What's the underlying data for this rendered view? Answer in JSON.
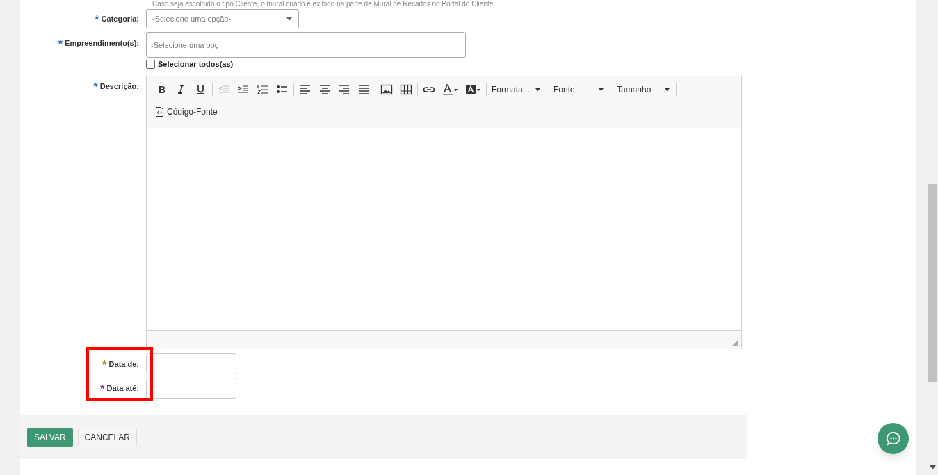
{
  "hint": "Caso seja escolhido o tipo Cliente, o mural criado é exibido na parte de Mural de Recados no Portal do Cliente.",
  "fields": [
    {
      "kind": "select",
      "label": "Categoria:",
      "required": "*",
      "color": "#2f6fb7",
      "placeholder": "-Selecione uma opção-"
    },
    {
      "kind": "multiselect",
      "label": "Empreendimento(s):",
      "required": "*",
      "color": "#2f6fb7",
      "placeholder": "-Selecione uma opç",
      "checkbox": {
        "label": "Selecionar todos(as)",
        "checked": false
      }
    },
    {
      "kind": "editor",
      "label": "Descrição:",
      "required": "*",
      "color": "#2f6fb7"
    },
    {
      "kind": "date",
      "label": "Data de:",
      "required": "*",
      "color": "#b8862b",
      "highlighted": true
    },
    {
      "kind": "date",
      "label": "Data até:",
      "required": "*",
      "color": "#8b2f8b",
      "highlighted": true
    }
  ],
  "editor": {
    "buttons": [
      {
        "disabled": false,
        "label": "B"
      },
      {
        "disabled": false
      },
      {
        "disabled": false
      },
      {
        "disabled": true
      },
      {
        "disabled": false
      },
      {
        "disabled": false
      },
      {
        "disabled": false
      },
      {
        "disabled": false
      },
      {
        "disabled": false
      },
      {
        "disabled": false
      },
      {
        "disabled": false
      },
      {
        "disabled": false
      },
      {
        "disabled": false
      },
      {
        "disabled": false
      },
      {
        "disabled": false
      },
      {
        "disabled": false
      }
    ],
    "dropdowns": [
      "Formata...",
      "Fonte",
      "Tamanho"
    ],
    "source_button": "Código-Fonte"
  },
  "actions": [
    {
      "label": "SALVAR",
      "kind": "primary"
    },
    {
      "label": "CANCELAR",
      "kind": "secondary"
    }
  ]
}
